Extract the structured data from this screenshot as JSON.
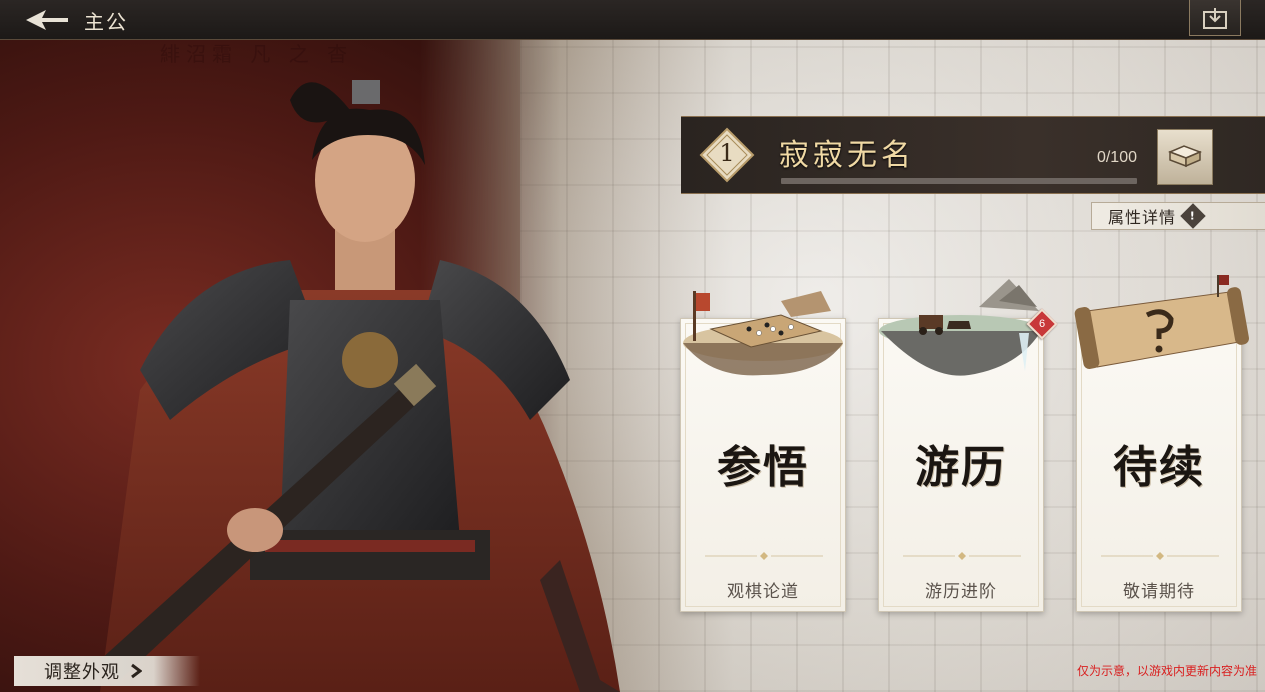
{
  "header": {
    "title": "主公",
    "back_icon": "back-arrow-icon",
    "right_icon": "export-box-icon"
  },
  "background": {
    "calligraphy": "緋沼霜 凡 之 杳"
  },
  "profile": {
    "level": "1",
    "name": "寂寂无名",
    "exp_text": "0/100",
    "exp_progress": 0,
    "banner_icon": "book-icon",
    "attr_detail_label": "属性详情",
    "attr_detail_icon": "info-icon"
  },
  "cards": [
    {
      "title": "参悟",
      "subtitle": "观棋论道",
      "art": "go-board-art",
      "badge": ""
    },
    {
      "title": "游历",
      "subtitle": "游历进阶",
      "art": "floating-island-carriage-art",
      "badge": "6"
    },
    {
      "title": "待续",
      "subtitle": "敬请期待",
      "art": "scroll-art",
      "badge": ""
    }
  ],
  "footer": {
    "adjust_label": "调整外观",
    "adjust_icon": "chevron-right-icon",
    "disclaimer": "仅为示意，以游戏内更新内容为准"
  },
  "colors": {
    "accent_gold": "#f0d9a4",
    "badge_red": "#c8383a",
    "disclaimer_red": "#d92020"
  }
}
